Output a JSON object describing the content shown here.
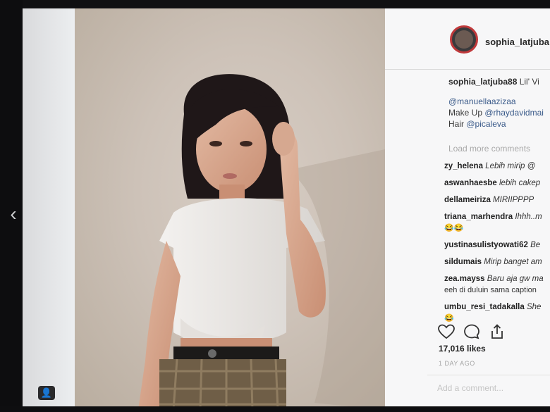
{
  "post": {
    "username": "sophia_latjuba88",
    "header_username": "sophia_latjuba",
    "caption_user": "sophia_latjuba88",
    "caption_text": "Lil' Vi",
    "caption_mentions": [
      {
        "prefix": "",
        "text": "@manuellaazizaa"
      },
      {
        "prefix": "Make Up ",
        "text": "@rhaydavidmai"
      },
      {
        "prefix": "Hair ",
        "text": "@picaleva"
      }
    ],
    "load_more": "Load more comments",
    "comments": [
      {
        "user": "zy_helena",
        "text": "Lebih mirip @",
        "emoji": ""
      },
      {
        "user": "aswanhaesbe",
        "text": "lebih cakep",
        "emoji": ""
      },
      {
        "user": "dellameiriza",
        "text": "MIRIIPPPP",
        "emoji": ""
      },
      {
        "user": "triana_marhendra",
        "text": "Ihhh..m",
        "emoji": "😂😂"
      },
      {
        "user": "yustinasulistyowati62",
        "text": "Be",
        "emoji": ""
      },
      {
        "user": "sildumais",
        "text": "Mirip banget am",
        "emoji": ""
      },
      {
        "user": "zea.mayss",
        "text": "Baru aja gw ma",
        "extra": "eeh di duluin sama caption",
        "emoji": ""
      },
      {
        "user": "umbu_resi_tadakalla",
        "text": "She",
        "emoji": "😂"
      }
    ],
    "likes": "17,016 likes",
    "time_ago": "1 DAY AGO",
    "add_comment_placeholder": "Add a comment..."
  },
  "icons": {
    "prev": "chevron-left-icon",
    "like": "heart-icon",
    "comment": "comment-icon",
    "share": "share-icon",
    "profile": "profile-icon"
  },
  "colors": {
    "avatar_ring": "#c0393b",
    "mention": "#3b5b8a"
  }
}
